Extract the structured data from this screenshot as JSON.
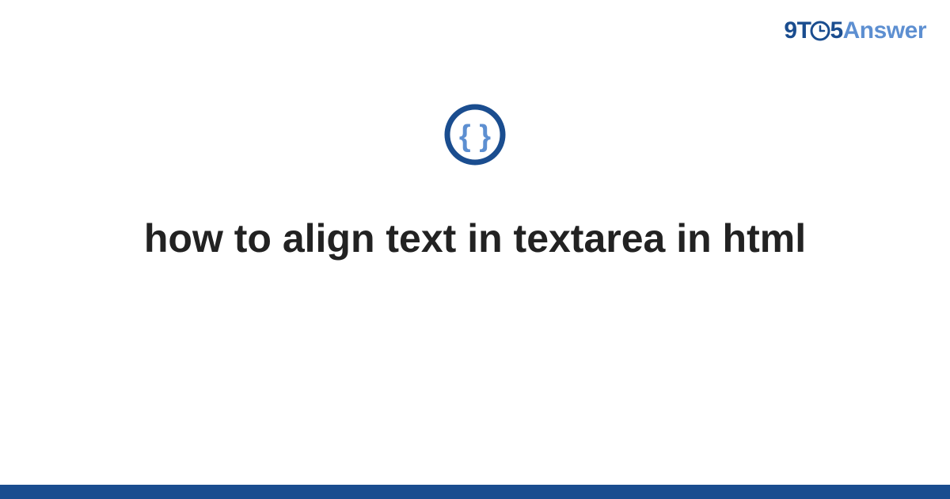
{
  "logo": {
    "part1": "9T",
    "part2": "5",
    "part3": "Answer"
  },
  "category_icon": "braces-icon",
  "title": "how to align text in textarea in html",
  "colors": {
    "brand_dark": "#1a4d8f",
    "brand_light": "#5d8fd1",
    "text": "#222222"
  }
}
